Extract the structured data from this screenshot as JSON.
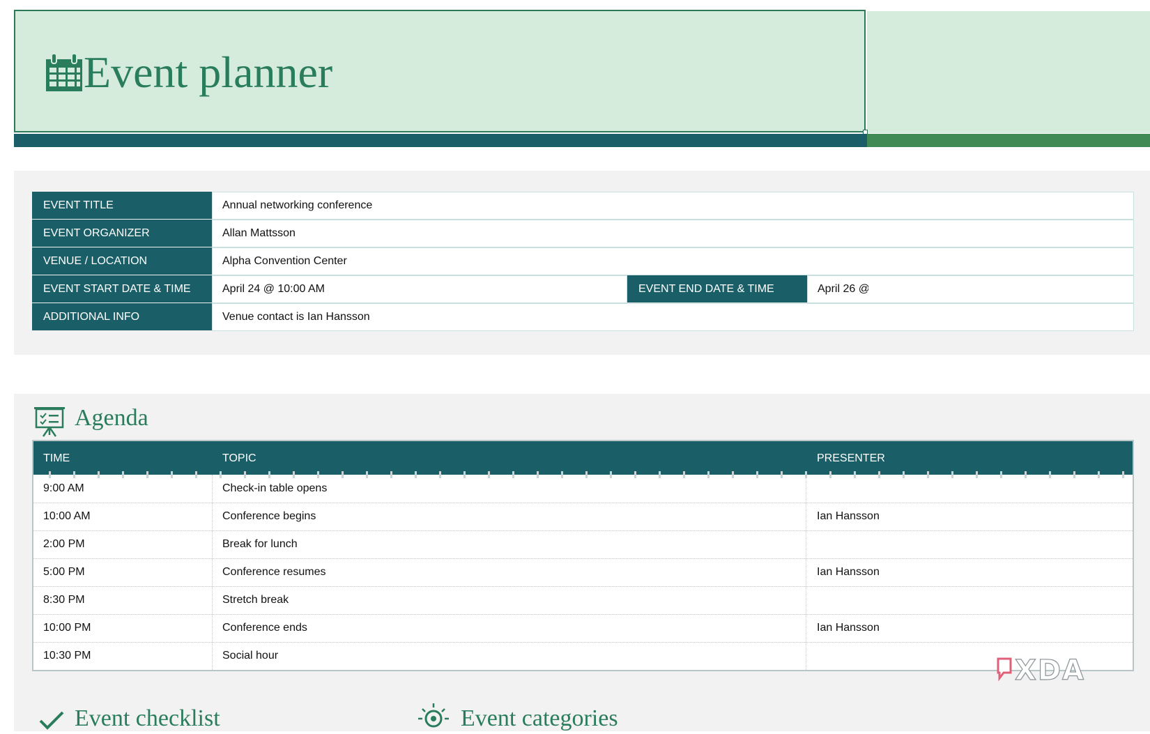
{
  "header": {
    "title": "Event planner",
    "icon": "calendar-icon"
  },
  "details": {
    "rows": [
      {
        "label": "EVENT TITLE",
        "value": "Annual networking conference"
      },
      {
        "label": "EVENT ORGANIZER",
        "value": "Allan Mattsson"
      },
      {
        "label": "VENUE / LOCATION",
        "value": "Alpha Convention Center"
      },
      {
        "label": "EVENT START DATE & TIME",
        "value": "April 24 @ 10:00 AM"
      },
      {
        "label": "ADDITIONAL INFO",
        "value": "Venue contact is Ian Hansson"
      }
    ],
    "end": {
      "label": "EVENT END DATE & TIME",
      "value": "April 26 @"
    }
  },
  "agenda": {
    "title": "Agenda",
    "icon": "presentation-board-icon",
    "columns": [
      "TIME",
      "TOPIC",
      "PRESENTER"
    ],
    "rows": [
      {
        "time": "9:00 AM",
        "topic": "Check-in table opens",
        "presenter": ""
      },
      {
        "time": "10:00 AM",
        "topic": "Conference begins",
        "presenter": "Ian Hansson"
      },
      {
        "time": "2:00 PM",
        "topic": "Break for lunch",
        "presenter": ""
      },
      {
        "time": "5:00 PM",
        "topic": "Conference resumes",
        "presenter": "Ian Hansson"
      },
      {
        "time": "8:30 PM",
        "topic": "Stretch break",
        "presenter": ""
      },
      {
        "time": "10:00 PM",
        "topic": "Conference ends",
        "presenter": "Ian Hansson"
      },
      {
        "time": "10:30 PM",
        "topic": "Social hour",
        "presenter": ""
      }
    ]
  },
  "checklist": {
    "title": "Event checklist",
    "icon": "checkmark-icon"
  },
  "categories": {
    "title": "Event categories",
    "icon": "gear-lightbulb-icon"
  },
  "watermark": {
    "text": "XDA"
  },
  "colors": {
    "teal": "#1a5f68",
    "mint": "#d5ebdc",
    "green": "#2a7d5c",
    "panel": "#f2f2f2"
  }
}
